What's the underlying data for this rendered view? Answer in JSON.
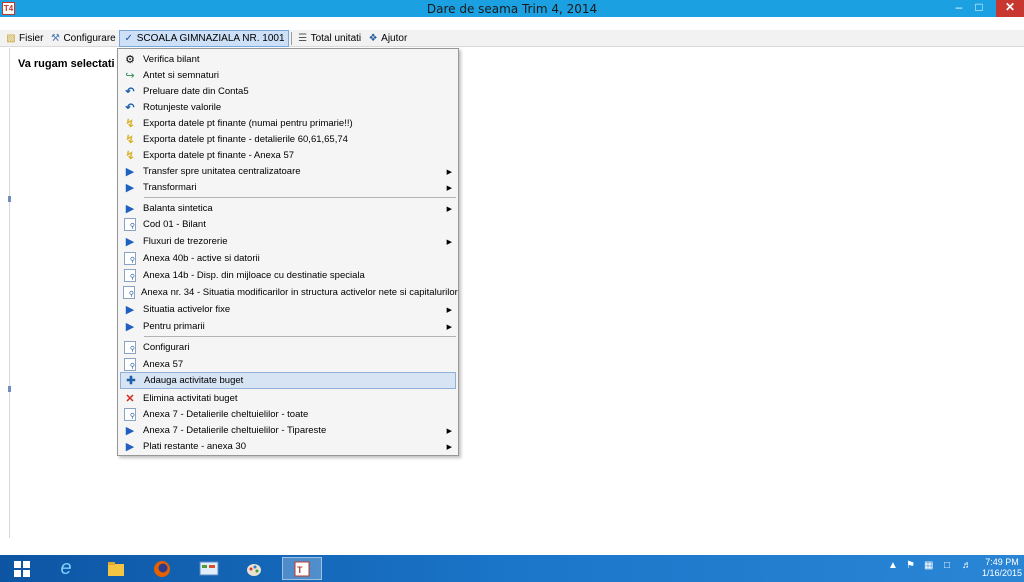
{
  "window": {
    "title": "Dare de seama Trim 4, 2014",
    "app_icon": "T4",
    "minimize_glyph": "–",
    "maximize_glyph": "□",
    "close_glyph": "✕"
  },
  "menubar": {
    "items": [
      {
        "label": "Fisier",
        "icon": "folder-icon"
      },
      {
        "label": "Configurare",
        "icon": "tools-icon"
      },
      {
        "label": "SCOALA GIMNAZIALA NR. 1001",
        "icon": "check-icon",
        "active": true
      },
      {
        "label": "Total unitati",
        "icon": "list-icon"
      },
      {
        "label": "Ajutor",
        "icon": "help-icon"
      }
    ]
  },
  "content": {
    "prompt": "Va rugam selectati"
  },
  "dropdown": {
    "items": [
      {
        "label": "Verifica bilant",
        "icon": "gear-icon"
      },
      {
        "label": "Antet si semnaturi",
        "icon": "export-icon"
      },
      {
        "label": "Preluare date din Conta5",
        "icon": "link-icon"
      },
      {
        "label": "Rotunjeste valorile",
        "icon": "link-icon"
      },
      {
        "label": "Exporta datele pt finante (numai pentru primarie!!)",
        "icon": "bolt-icon"
      },
      {
        "label": "Exporta datele pt finante - detalierile 60,61,65,74",
        "icon": "bolt-icon"
      },
      {
        "label": "Exporta datele pt finante - Anexa 57",
        "icon": "bolt-icon"
      },
      {
        "label": "Transfer spre unitatea centralizatoare",
        "icon": "play-icon",
        "submenu": true
      },
      {
        "label": "Transformari",
        "icon": "play-icon",
        "submenu": true
      },
      {
        "label": "Balanta sintetica",
        "icon": "play-icon",
        "submenu": true
      },
      {
        "label": "Cod 01 - Bilant",
        "icon": "preview-icon"
      },
      {
        "label": "Fluxuri de trezorerie",
        "icon": "play-icon",
        "submenu": true
      },
      {
        "label": "Anexa 40b - active si datorii",
        "icon": "preview-icon"
      },
      {
        "label": "Anexa 14b - Disp. din mijloace cu destinatie speciala",
        "icon": "preview-icon"
      },
      {
        "label": "Anexa nr. 34 - Situatia modificarilor in structura activelor nete si capitalurilor",
        "icon": "preview-icon"
      },
      {
        "label": "Situatia activelor fixe",
        "icon": "play-icon",
        "submenu": true
      },
      {
        "label": "Pentru primarii",
        "icon": "play-icon",
        "submenu": true
      },
      {
        "label": "Configurari",
        "icon": "preview-icon"
      },
      {
        "label": "Anexa 57",
        "icon": "preview-icon"
      },
      {
        "label": "Adauga activitate buget",
        "icon": "plus-icon",
        "highlighted": true
      },
      {
        "label": "Elimina activitati buget",
        "icon": "delete-icon"
      },
      {
        "label": "Anexa 7 - Detalierile cheltuielilor - toate",
        "icon": "preview-icon"
      },
      {
        "label": "Anexa 7 - Detalierile cheltuielilor - Tipareste",
        "icon": "play-icon",
        "submenu": true
      },
      {
        "label": "Plati restante - anexa 30",
        "icon": "play-icon",
        "submenu": true
      }
    ]
  },
  "taskbar": {
    "clock_time": "7:49 PM",
    "clock_date": "1/16/2015"
  }
}
